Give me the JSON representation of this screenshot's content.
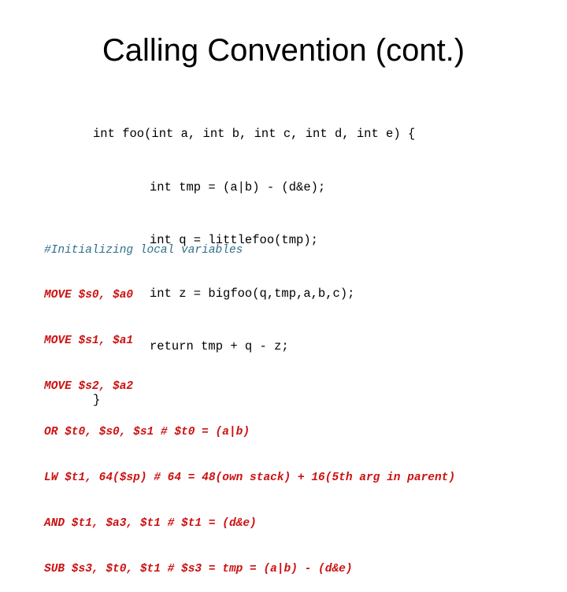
{
  "slide": {
    "title": "Calling Convention (cont.)",
    "c_code": {
      "lines": [
        "int foo(int a, int b, int c, int d, int e) {",
        "int tmp = (a|b) - (d&e);",
        "int q = littlefoo(tmp);",
        "int z = bigfoo(q,tmp,a,b,c);",
        "return tmp + q - z;",
        "}"
      ]
    },
    "asm_code": {
      "comment": "#Initializing local variables",
      "lines": [
        "MOVE $s0, $a0",
        "MOVE $s1, $a1",
        "MOVE $s2, $a2",
        "OR $t0, $s0, $s1 # $t0 = (a|b)",
        "LW $t1, 64($sp) # 64 = 48(own stack) + 16(5th arg in parent)",
        "AND $t1, $a3, $t1 # $t1 = (d&e)",
        "SUB $s3, $t0, $t1 # $s3 = tmp = (a|b) - (d&e)"
      ]
    },
    "colors": {
      "comment": "#2e6f8a",
      "instruction": "#cc1111",
      "c_code": "#000000"
    }
  }
}
